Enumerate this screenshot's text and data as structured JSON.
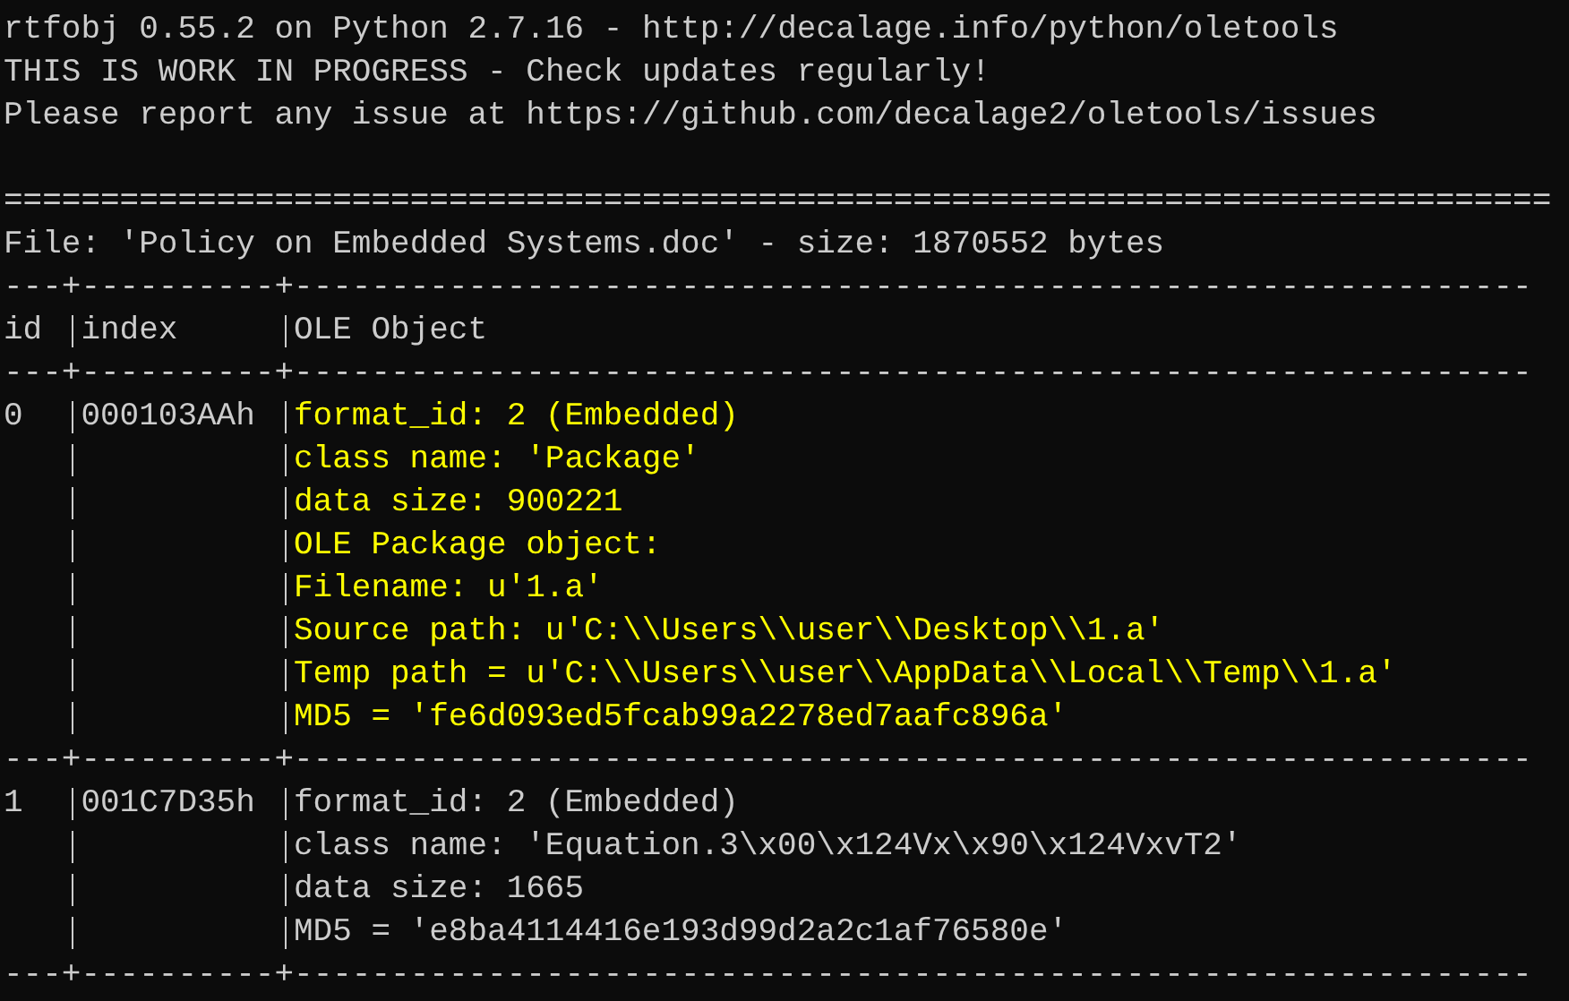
{
  "lines": [
    "rtfobj 0.55.2 on Python 2.7.16 - http://decalage.info/python/oletools",
    "THIS IS WORK IN PROGRESS - Check updates regularly!",
    "Please report any issue at https://github.com/decalage2/oletools/issues"
  ],
  "double_rule": "================================================================================",
  "file_line": "File: 'Policy on Embedded Systems.doc' - size: 1870552 bytes",
  "table": {
    "top_rule": "---+----------+----------------------------------------------------------------",
    "columns": [
      "id",
      "index",
      "OLE Object"
    ],
    "header_rule": "---+----------+----------------------------------------------------------------",
    "rows": [
      {
        "id": "0",
        "index": "000103AAh",
        "color": "#ffff00",
        "lines": [
          "format_id: 2 (Embedded)",
          "class name: 'Package'",
          "data size: 900221",
          "OLE Package object:",
          "Filename: u'1.a'",
          "Source path: u'C:\\\\Users\\\\user\\\\Desktop\\\\1.a'",
          "Temp path = u'C:\\\\Users\\\\user\\\\AppData\\\\Local\\\\Temp\\\\1.a'",
          "MD5 = 'fe6d093ed5fcab99a2278ed7aafc896a'"
        ],
        "rule": "---+----------+----------------------------------------------------------------"
      },
      {
        "id": "1",
        "index": "001C7D35h",
        "color": "#cccccc",
        "lines": [
          "format_id: 2 (Embedded)",
          "class name: 'Equation.3\\x00\\x124Vx\\x90\\x124VxvT2'",
          "data size: 1665",
          "MD5 = 'e8ba4114416e193d99d2a2c1af76580e'"
        ],
        "rule": "---+----------+----------------------------------------------------------------"
      }
    ]
  }
}
